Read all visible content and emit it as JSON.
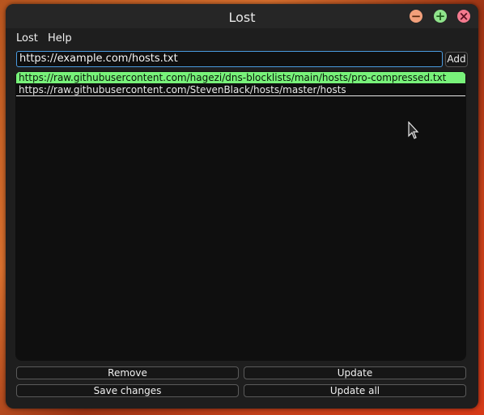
{
  "window": {
    "title": "Lost",
    "controls": {
      "minimize": "−",
      "maximize": "+",
      "close": "×"
    }
  },
  "menu": {
    "items": [
      "Lost",
      "Help"
    ]
  },
  "url_input": {
    "value": "https://example.com/hosts.txt"
  },
  "add_button": {
    "label": "Add"
  },
  "list": {
    "items": [
      {
        "url": "https://raw.githubusercontent.com/hagezi/dns-blocklists/main/hosts/pro-compressed.txt",
        "selected": true
      },
      {
        "url": "https://raw.githubusercontent.com/StevenBlack/hosts/master/hosts",
        "selected": false
      }
    ]
  },
  "buttons": {
    "remove": "Remove",
    "update": "Update",
    "save_changes": "Save changes",
    "update_all": "Update all"
  },
  "colors": {
    "selection": "#78f27a",
    "focus_border": "#4a9be0",
    "minimize": "#f2a07b",
    "maximize": "#8fe38b",
    "close": "#f47a8f"
  }
}
